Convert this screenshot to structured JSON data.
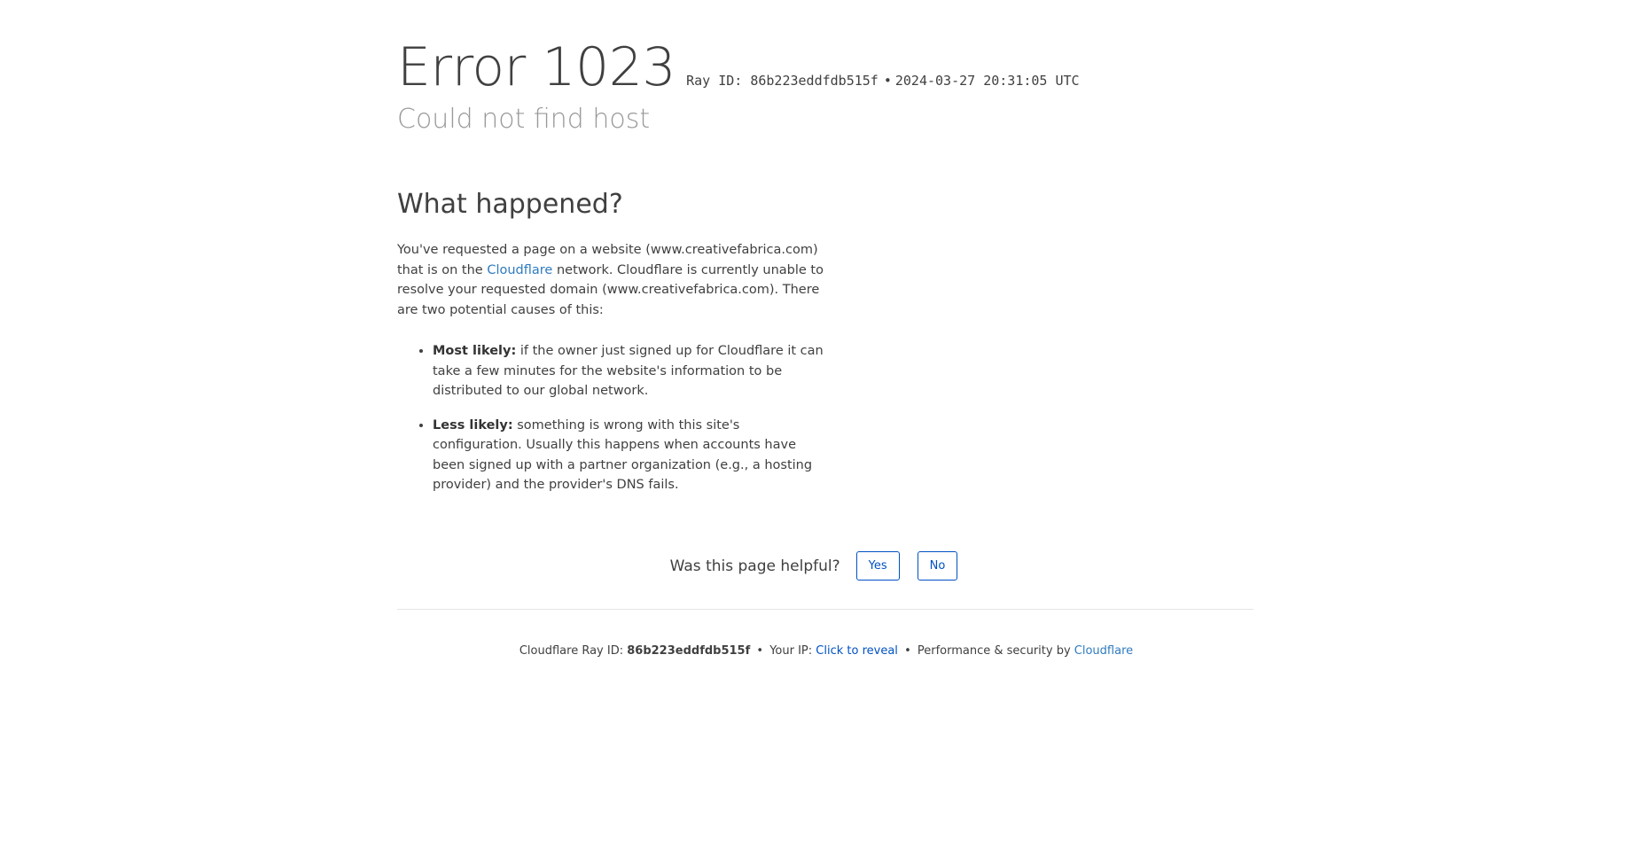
{
  "header": {
    "title": "Error 1023",
    "ray_label": "Ray ID: 86b223eddfdb515f",
    "separator": "•",
    "timestamp": "2024-03-27 20:31:05 UTC",
    "subtitle": "Could not find host"
  },
  "what_happened": {
    "heading": "What happened?",
    "para_part1": "You've requested a page on a website (www.creativefabrica.com) that is on the ",
    "para_link": "Cloudflare",
    "para_part2": " network. Cloudflare is currently unable to resolve your requested domain (www.creativefabrica.com). There are two potential causes of this:",
    "causes": [
      {
        "label": "Most likely:",
        "text": " if the owner just signed up for Cloudflare it can take a few minutes for the website's information to be distributed to our global network."
      },
      {
        "label": "Less likely:",
        "text": " something is wrong with this site's configuration. Usually this happens when accounts have been signed up with a partner organization (e.g., a hosting provider) and the provider's DNS fails."
      }
    ]
  },
  "feedback": {
    "question": "Was this page helpful?",
    "yes_label": "Yes",
    "no_label": "No"
  },
  "footer": {
    "ray_prefix": "Cloudflare Ray ID: ",
    "ray_id": "86b223eddfdb515f",
    "sep": "•",
    "ip_prefix": "Your IP: ",
    "ip_link": "Click to reveal",
    "perf_text": "Performance & security by ",
    "cf_link": "Cloudflare"
  },
  "colors": {
    "text": "#404040",
    "muted": "#999999",
    "link": "#2f7bbf",
    "button_blue": "#0051c3",
    "divider": "#e5e5e5"
  }
}
